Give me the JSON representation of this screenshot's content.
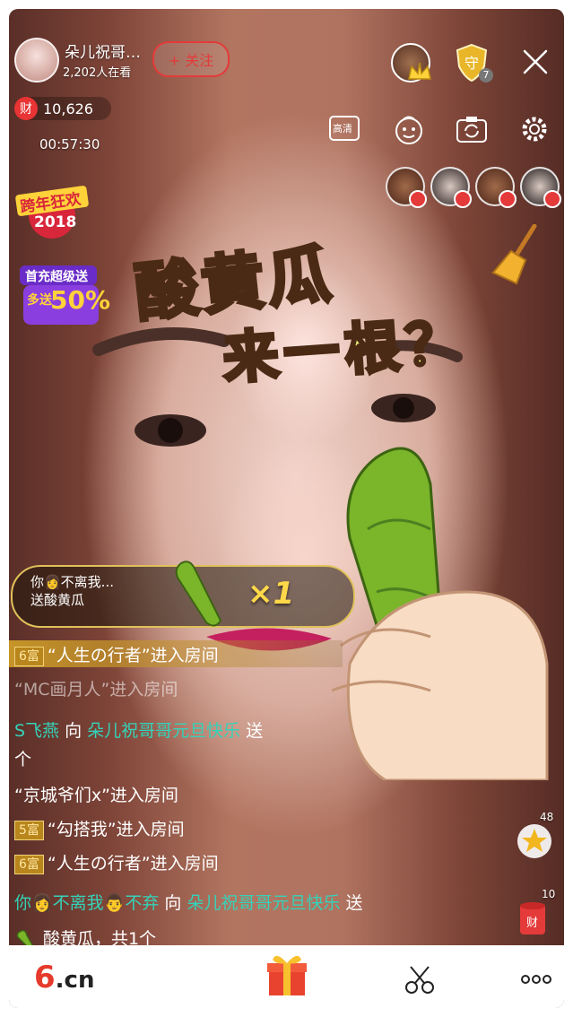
{
  "header": {
    "streamer_name": "朵儿祝哥…",
    "viewers": "2,202人在看",
    "follow_label": "+ 关注",
    "coin_icon_label": "财",
    "coins": "10,626",
    "timer": "00:57:30",
    "guard_count": "7",
    "quality_label": "高清"
  },
  "promos": {
    "badge_2018_line1": "跨年狂欢",
    "badge_2018_line2": "2018",
    "first_charge_line1": "首充超级送",
    "first_charge_line2": "多送",
    "first_charge_pct": "50%"
  },
  "sticker": {
    "line1": "酸黄瓜",
    "line2": "来一根？"
  },
  "gift_banner": {
    "line1": "你👩不离我...",
    "line2": "送酸黄瓜",
    "count": "×1"
  },
  "chat": [
    {
      "tag": "6富",
      "text": "“人生の行者”进入房间"
    },
    {
      "text": "“MC画月人”进入房间"
    },
    {
      "sender": "S飞燕",
      "verb": "向",
      "target": "朵儿祝哥哥元旦快乐",
      "tail": "送",
      "cont": "个"
    },
    {
      "text": "“京城爷们x”进入房间"
    },
    {
      "tag": "5富",
      "text": "“勾搭我”进入房间"
    },
    {
      "tag": "6富",
      "text": "“人生の行者”进入房间"
    },
    {
      "sender": "你👩不离我👨不弃",
      "verb": "向",
      "target": "朵儿祝哥哥元旦快乐",
      "tail": "送",
      "cont": "酸黄瓜，共1个"
    }
  ],
  "side": {
    "star_count": "48",
    "wealth_label": "财",
    "wealth_count": "10"
  },
  "bottom": {
    "logo_main": "6",
    "logo_suffix": ".cn"
  },
  "colors": {
    "accent_red": "#e43a3a",
    "chat_name_teal": "#35d2b8",
    "gold": "#e0c15a"
  }
}
